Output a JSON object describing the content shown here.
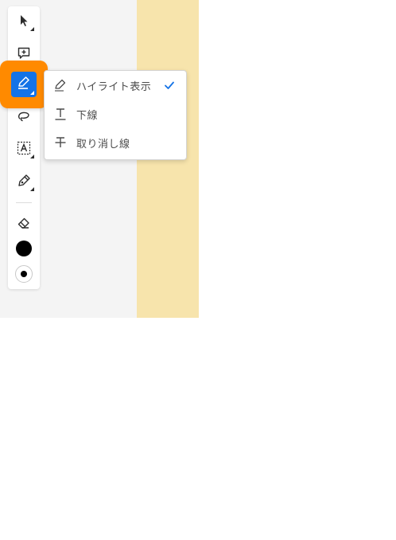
{
  "toolbar": {
    "tools": [
      {
        "name": "select-tool",
        "icon": "cursor-icon"
      },
      {
        "name": "comment-tool",
        "icon": "add-comment-icon"
      },
      {
        "name": "highlight-tool",
        "icon": "highlighter-icon",
        "active": true
      },
      {
        "name": "lasso-tool",
        "icon": "lasso-icon"
      },
      {
        "name": "text-tool",
        "icon": "text-box-icon"
      },
      {
        "name": "draw-tool",
        "icon": "pen-icon"
      },
      {
        "name": "eraser-tool",
        "icon": "eraser-icon"
      }
    ],
    "color": "#000000",
    "accent": "#1473e6",
    "spotlight_color": "#ff8a00"
  },
  "menu": {
    "items": [
      {
        "label": "ハイライト表示",
        "icon": "highlighter-icon",
        "checked": true
      },
      {
        "label": "下線",
        "icon": "underline-icon",
        "checked": false
      },
      {
        "label": "取り消し線",
        "icon": "strikethrough-icon",
        "checked": false
      }
    ]
  }
}
